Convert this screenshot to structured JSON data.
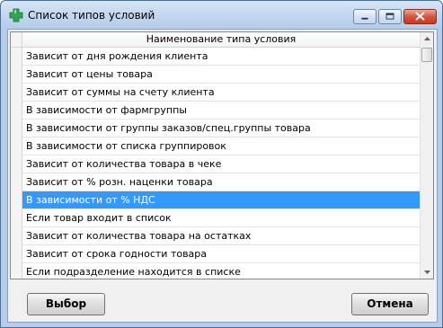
{
  "window": {
    "title": "Список типов условий",
    "icon": "green-cross-icon",
    "controls": [
      "minimize-icon",
      "maximize-icon",
      "close-icon"
    ]
  },
  "table": {
    "column_header": "Наименование типа условия",
    "rows": [
      "Зависит от дня рождения клиента",
      "Зависит от цены товара",
      "Зависит от суммы на счету клиента",
      "В зависимости от фармгруппы",
      "В зависимости от группы заказов/спец.группы товара",
      "В зависимости от списка группировок",
      "Зависит от количества товара в чеке",
      "Зависит от % розн. наценки товара",
      "В зависимости от % НДС",
      "Если товар входит в список",
      "Зависит от количества товара на остатках",
      "Зависит от срока годности товара",
      "Если подразделение находится в списке"
    ],
    "selected_index": 8
  },
  "buttons": {
    "choose_label": "Выбор",
    "cancel_label": "Отмена"
  },
  "colors": {
    "selection": "#3399ff",
    "icon_green": "#2fa84f"
  }
}
